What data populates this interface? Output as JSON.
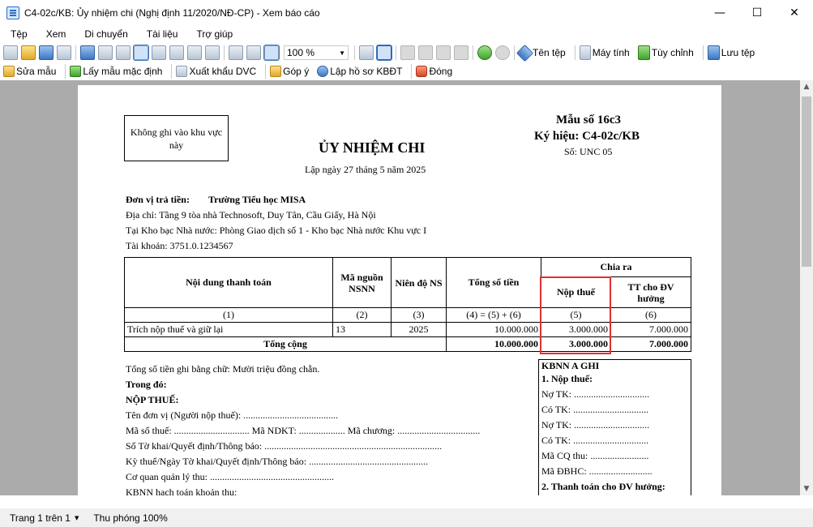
{
  "window": {
    "title": "C4-02c/KB: Ủy nhiệm chi (Nghị định 11/2020/NĐ-CP) - Xem báo cáo",
    "minimize": "—",
    "maximize": "☐",
    "close": "✕"
  },
  "menu": [
    "Tệp",
    "Xem",
    "Di chuyển",
    "Tài liệu",
    "Trợ giúp"
  ],
  "toolbar1": {
    "zoom": "100 %",
    "ten_tep": "Tên tệp",
    "may_tinh": "Máy tính",
    "tuy_chinh": "Tùy chỉnh",
    "luu_tep": "Lưu tệp"
  },
  "toolbar2": {
    "sua_mau": "Sửa mẫu",
    "lay_mau": "Lấy mẫu mặc định",
    "xuat_khau": "Xuất khẩu DVC",
    "gop_y": "Góp ý",
    "lap_ho_so": "Lập hồ sơ KBĐT",
    "dong": "Đóng"
  },
  "doc": {
    "box_text": "Không ghi vào khu vực này",
    "mau_so": "Mẫu số 16c3",
    "ky_hieu": "Ký hiệu: C4-02c/KB",
    "so": "Số: UNC 05",
    "title": "ỦY NHIỆM CHI",
    "date": "Lập ngày 27 tháng 5 năm 2025",
    "don_vi_label": "Đơn vị trả tiền:",
    "don_vi": "Trường Tiểu học MISA",
    "dia_chi": "Địa chỉ: Tầng 9 tòa nhà Technosoft, Duy Tân, Cầu Giấy, Hà Nội",
    "kho_bac": "Tại Kho bạc Nhà nước: Phòng Giao dịch số 1 - Kho bạc Nhà nước Khu vực I",
    "tai_khoan": "Tài khoản: 3751.0.1234567",
    "table": {
      "h_noidung": "Nội dung thanh toán",
      "h_ma_nguon": "Mã nguồn NSNN",
      "h_nien_do": "Niên độ NS",
      "h_tong": "Tổng số tiền",
      "h_chia_ra": "Chia ra",
      "h_nop_thue": "Nộp thuế",
      "h_tt_dv": "TT cho ĐV hưởng",
      "n1": "(1)",
      "n2": "(2)",
      "n3": "(3)",
      "n4": "(4) = (5) + (6)",
      "n5": "(5)",
      "n6": "(6)",
      "row_noidung": "Trích nộp thuế và giữ lại",
      "row_ma": "13",
      "row_nien": "2025",
      "row_tong": "10.000.000",
      "row_thue": "3.000.000",
      "row_dv": "7.000.000",
      "total_label": "Tổng cộng",
      "total_tong": "10.000.000",
      "total_thue": "3.000.000",
      "total_dv": "7.000.000"
    },
    "bang_chu": "Tổng số tiền ghi bằng chữ: Mười triệu đồng chẵn.",
    "trong_do": "Trong đó:",
    "nop_thue": "NỘP THUẾ:",
    "ten_dv": "Tên đơn vị (Người nộp thuế): .......................................",
    "ma_so_thue": "Mã  số  thuế:  ...............................  Mã  NDKT:     ...................  Mã  chương:  ..................................",
    "so_to_khai": "Số  Tờ khai/Quyết định/Thông báo:  .........................................................................",
    "ky_thue": "Kỳ thuế/Ngày  Tờ khai/Quyết định/Thông báo: .................................................",
    "co_quan": "Cơ quan quản lý thu:  ...................................................",
    "kbnn_hach": "KBNN hạch toán khoản thu:",
    "kbnn_ghi": "KBNN A GHI",
    "kb_1": "1. Nộp thuế:",
    "kb_no1": "Nợ TK: ...............................",
    "kb_co1": "Có TK: ...............................",
    "kb_no2": "Nợ TK: ...............................",
    "kb_co2": "Có TK: ...............................",
    "kb_macq": "Mã CQ thu: ........................",
    "kb_madb": "Mã ĐBHC: ..........................",
    "kb_2": "2. Thanh toán cho ĐV hưởng:"
  },
  "status": {
    "page": "Trang 1 trên 1",
    "zoom": "Thu phóng 100%"
  }
}
